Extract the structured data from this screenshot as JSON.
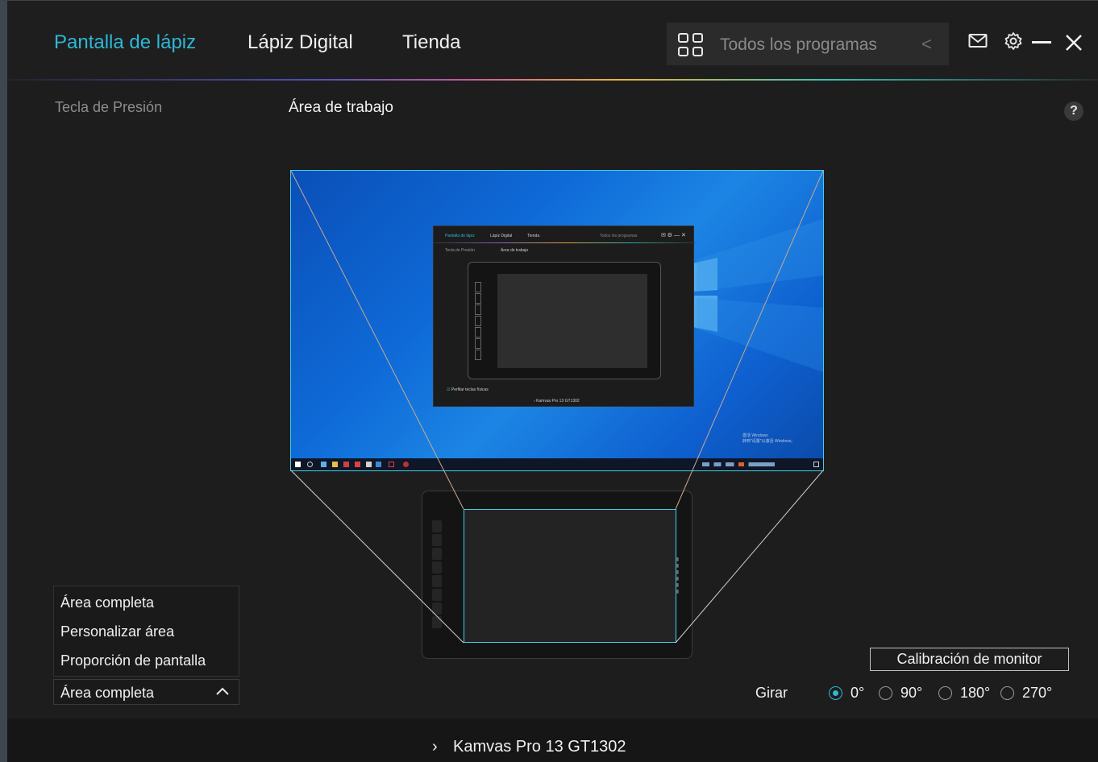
{
  "header": {
    "tabs": [
      {
        "label": "Pantalla de lápiz",
        "active": true
      },
      {
        "label": "Lápiz Digital",
        "active": false
      },
      {
        "label": "Tienda",
        "active": false
      }
    ],
    "programs_label": "Todos los programas",
    "icons": [
      "grid-icon",
      "chevron-left-icon",
      "mail-icon",
      "gear-icon",
      "minimize-icon",
      "close-icon"
    ]
  },
  "subheader": {
    "left_item": "Tecla de Presión",
    "title": "Área de trabajo",
    "help": "?"
  },
  "preview": {
    "mini_app": {
      "tabs": [
        "Pantalla de lápiz",
        "Lápiz Digital",
        "Tienda"
      ],
      "programs": "Todos los programas",
      "left_item": "Tecla de Presión",
      "title": "Área de trabajo",
      "checkbox": "Perfilar teclas físicas",
      "device": "Kamvas Pro 13 GT1302"
    },
    "watermark": [
      "激活 Windows",
      "转到\"设置\"以激活 Windows。"
    ]
  },
  "dropdown": {
    "options": [
      "Área completa",
      "Personalizar área",
      "Proporción de pantalla"
    ],
    "selected": "Área completa"
  },
  "calibration_button": "Calibración de monitor",
  "rotate": {
    "label": "Girar",
    "options": [
      "0°",
      "90°",
      "180°",
      "270°"
    ],
    "selected": "0°"
  },
  "footer": {
    "device": "Kamvas Pro 13 GT1302"
  },
  "colors": {
    "accent": "#2fb7d6",
    "background": "#1d1d1d"
  }
}
